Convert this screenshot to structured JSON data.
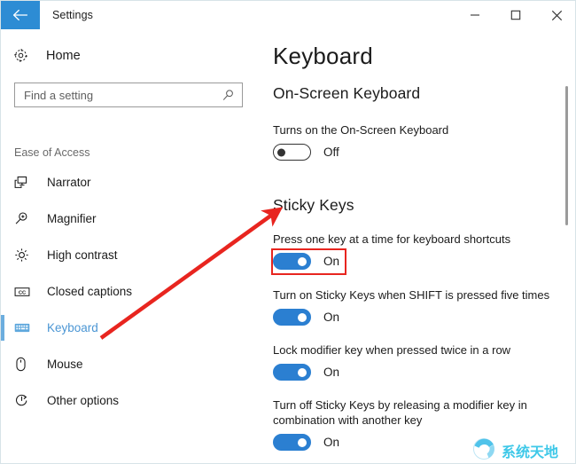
{
  "window": {
    "title": "Settings",
    "back_icon": "back-arrow-icon",
    "minimize_icon": "minimize-icon",
    "maximize_icon": "maximize-icon",
    "close_icon": "close-icon"
  },
  "sidebar": {
    "home": {
      "label": "Home",
      "icon": "gear-icon"
    },
    "search": {
      "value": "",
      "placeholder": "Find a setting",
      "icon": "search-icon"
    },
    "group_title": "Ease of Access",
    "items": [
      {
        "label": "Narrator",
        "icon": "narrator-icon",
        "selected": false
      },
      {
        "label": "Magnifier",
        "icon": "magnifier-icon",
        "selected": false
      },
      {
        "label": "High contrast",
        "icon": "high-contrast-icon",
        "selected": false
      },
      {
        "label": "Closed captions",
        "icon": "closed-captions-icon",
        "selected": false
      },
      {
        "label": "Keyboard",
        "icon": "keyboard-icon",
        "selected": true
      },
      {
        "label": "Mouse",
        "icon": "mouse-icon",
        "selected": false
      },
      {
        "label": "Other options",
        "icon": "other-options-icon",
        "selected": false
      }
    ]
  },
  "main": {
    "page_title": "Keyboard",
    "sections": [
      {
        "heading": "On-Screen Keyboard",
        "settings": [
          {
            "description": "Turns on the On-Screen Keyboard",
            "toggle_state": "Off",
            "toggle_on": false
          }
        ]
      },
      {
        "heading": "Sticky Keys",
        "settings": [
          {
            "description": "Press one key at a time for keyboard shortcuts",
            "toggle_state": "On",
            "toggle_on": true
          },
          {
            "description": "Turn on Sticky Keys when SHIFT is pressed five times",
            "toggle_state": "On",
            "toggle_on": true
          },
          {
            "description": "Lock modifier key when pressed twice in a row",
            "toggle_state": "On",
            "toggle_on": true
          },
          {
            "description": "Turn off Sticky Keys by releasing a modifier key in combination with another key",
            "toggle_state": "On",
            "toggle_on": true
          }
        ]
      }
    ]
  },
  "annotations": {
    "arrow_color": "#e8251f",
    "highlight_color": "#e8251f"
  },
  "watermark": {
    "text": "系统天地"
  },
  "colors": {
    "accent_blue": "#2b7fd1",
    "title_back_blue": "#2d8cd4",
    "selected_text_blue": "#4b96d4"
  }
}
